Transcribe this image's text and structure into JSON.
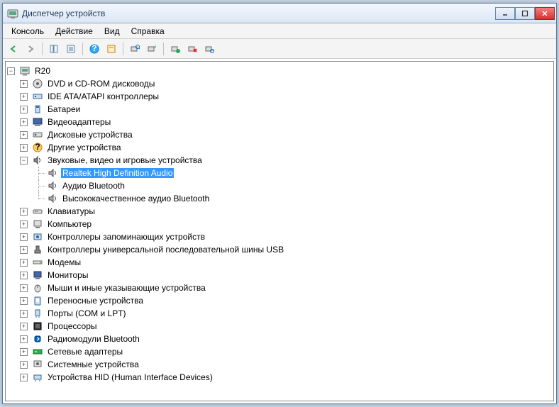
{
  "window": {
    "title": "Диспетчер устройств"
  },
  "menu": {
    "console": "Консоль",
    "action": "Действие",
    "view": "Вид",
    "help": "Справка"
  },
  "tree": {
    "root": "R20",
    "nodes": [
      {
        "label": "DVD и CD-ROM дисководы"
      },
      {
        "label": "IDE ATA/ATAPI контроллеры"
      },
      {
        "label": "Батареи"
      },
      {
        "label": "Видеоадаптеры"
      },
      {
        "label": "Дисковые устройства"
      },
      {
        "label": "Другие устройства"
      },
      {
        "label": "Звуковые, видео и игровые устройства",
        "expanded": true,
        "children": [
          {
            "label": "Realtek High Definition Audio",
            "selected": true
          },
          {
            "label": "Аудио Bluetooth"
          },
          {
            "label": "Высококачественное аудио Bluetooth"
          }
        ]
      },
      {
        "label": "Клавиатуры"
      },
      {
        "label": "Компьютер"
      },
      {
        "label": "Контроллеры запоминающих устройств"
      },
      {
        "label": "Контроллеры универсальной последовательной шины USB"
      },
      {
        "label": "Модемы"
      },
      {
        "label": "Мониторы"
      },
      {
        "label": "Мыши и иные указывающие устройства"
      },
      {
        "label": "Переносные устройства"
      },
      {
        "label": "Порты (COM и LPT)"
      },
      {
        "label": "Процессоры"
      },
      {
        "label": "Радиомодули Bluetooth"
      },
      {
        "label": "Сетевые адаптеры"
      },
      {
        "label": "Системные устройства"
      },
      {
        "label": "Устройства HID (Human Interface Devices)"
      }
    ]
  }
}
